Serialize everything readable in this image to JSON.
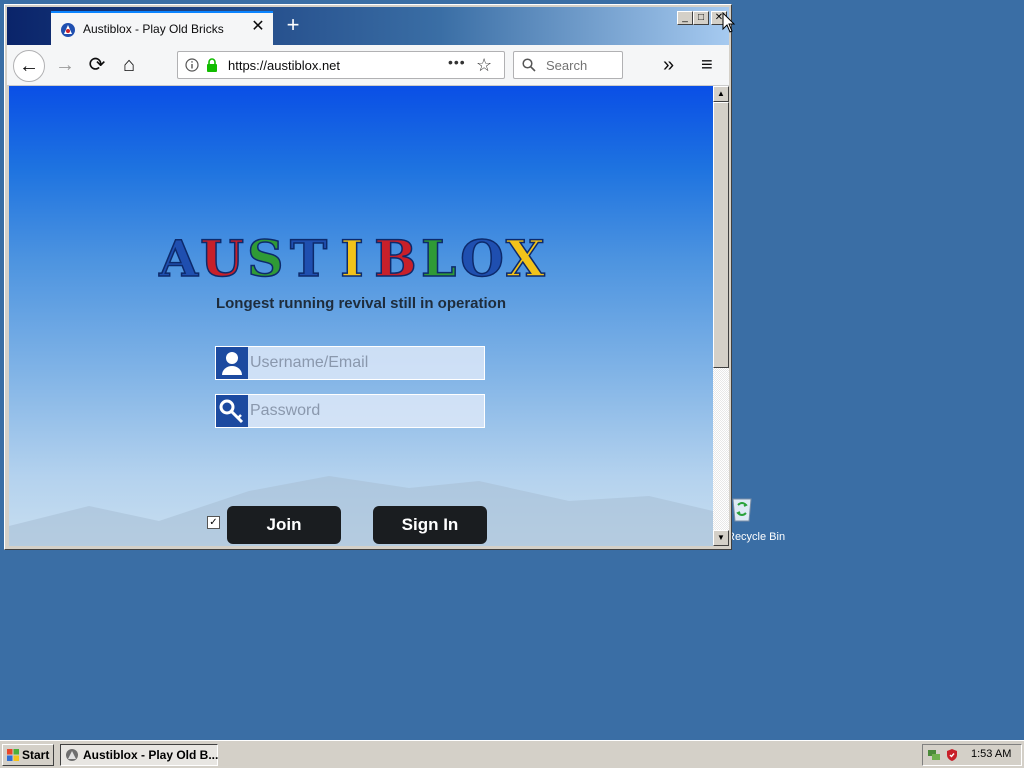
{
  "desktop": {
    "recycle_bin_label": "Recycle Bin"
  },
  "browser": {
    "tab_title": "Austiblox - Play Old Bricks",
    "tab_close": "✕",
    "new_tab": "+",
    "url": "https://austiblox.net",
    "page_actions": "•••",
    "bookmark_star": "☆",
    "search_placeholder": "Search",
    "overflow": "»",
    "menu": "≡",
    "back": "←",
    "forward": "→",
    "reload": "⟳",
    "home": "⌂",
    "win_minimize": "_",
    "win_maximize": "□",
    "win_close": "✕"
  },
  "page": {
    "logo_text": "AUSTIBLOX",
    "logo_colors": [
      "#1f4fb0",
      "#c8202a",
      "#2f9a36",
      "#1f4fb0",
      "#f2c31a",
      "#c8202a",
      "#2f9a36",
      "#1f4fb0",
      "#f2c31a"
    ],
    "tagline": "Longest running revival still in operation",
    "username_placeholder": "Username/Email",
    "password_placeholder": "Password",
    "remember_checked": true,
    "join_label": "Join",
    "signin_label": "Sign In"
  },
  "taskbar": {
    "start_label": "Start",
    "task_label": "Austiblox - Play Old B...",
    "clock": "1:53 AM"
  }
}
